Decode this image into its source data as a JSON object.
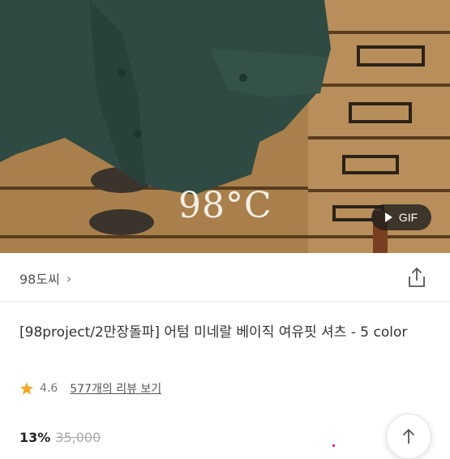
{
  "hero": {
    "brand_mark": "98°C",
    "gif_badge": "GIF",
    "play_icon": "play-icon"
  },
  "store": {
    "name": "98도씨",
    "chevron": "›",
    "share_icon": "share-icon"
  },
  "product": {
    "title": "[98project/2만장돌파] 어텀 미네랄 베이직 여유핏 셔츠 - 5 color",
    "rating": "4.6",
    "review_link": "577개의 리뷰 보기",
    "discount": "13%",
    "original_price": "35,000"
  },
  "colors": {
    "star": "#f5a623",
    "brand_text": "#f3efe6"
  },
  "scroll_top_icon": "arrow-up-icon"
}
